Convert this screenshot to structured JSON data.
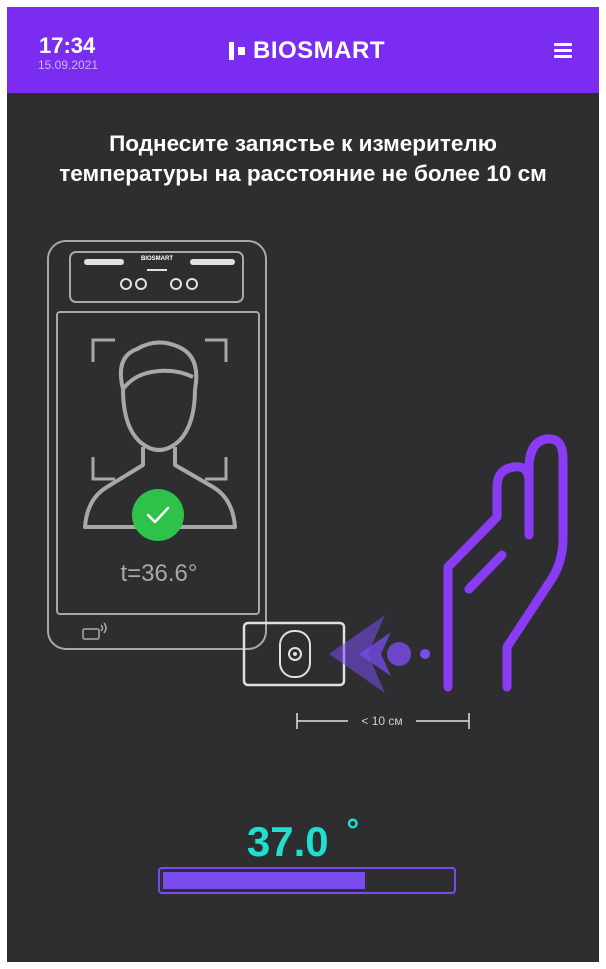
{
  "status": {
    "time": "17:34",
    "date": "15.09.2021"
  },
  "header": {
    "brand": "BIOSMART",
    "menu_icon": "hamburger-menu-icon"
  },
  "instruction": {
    "line1": "Поднесите запястье к измерителю",
    "line2": "температуры на расстояние не более 10 см"
  },
  "illustration": {
    "device_brand": "BIOSMART",
    "face_temperature": "t=36.6°",
    "distance_label": "< 10 см",
    "check_icon": "check-icon"
  },
  "measurement": {
    "temperature": "37.0",
    "unit": "°",
    "progress_fraction": 0.7
  },
  "colors": {
    "accent": "#7a2cf0",
    "background": "#2e2e30",
    "temperature": "#1fe0d0",
    "success": "#2ec24a",
    "line_art": "#a8a8a8"
  }
}
